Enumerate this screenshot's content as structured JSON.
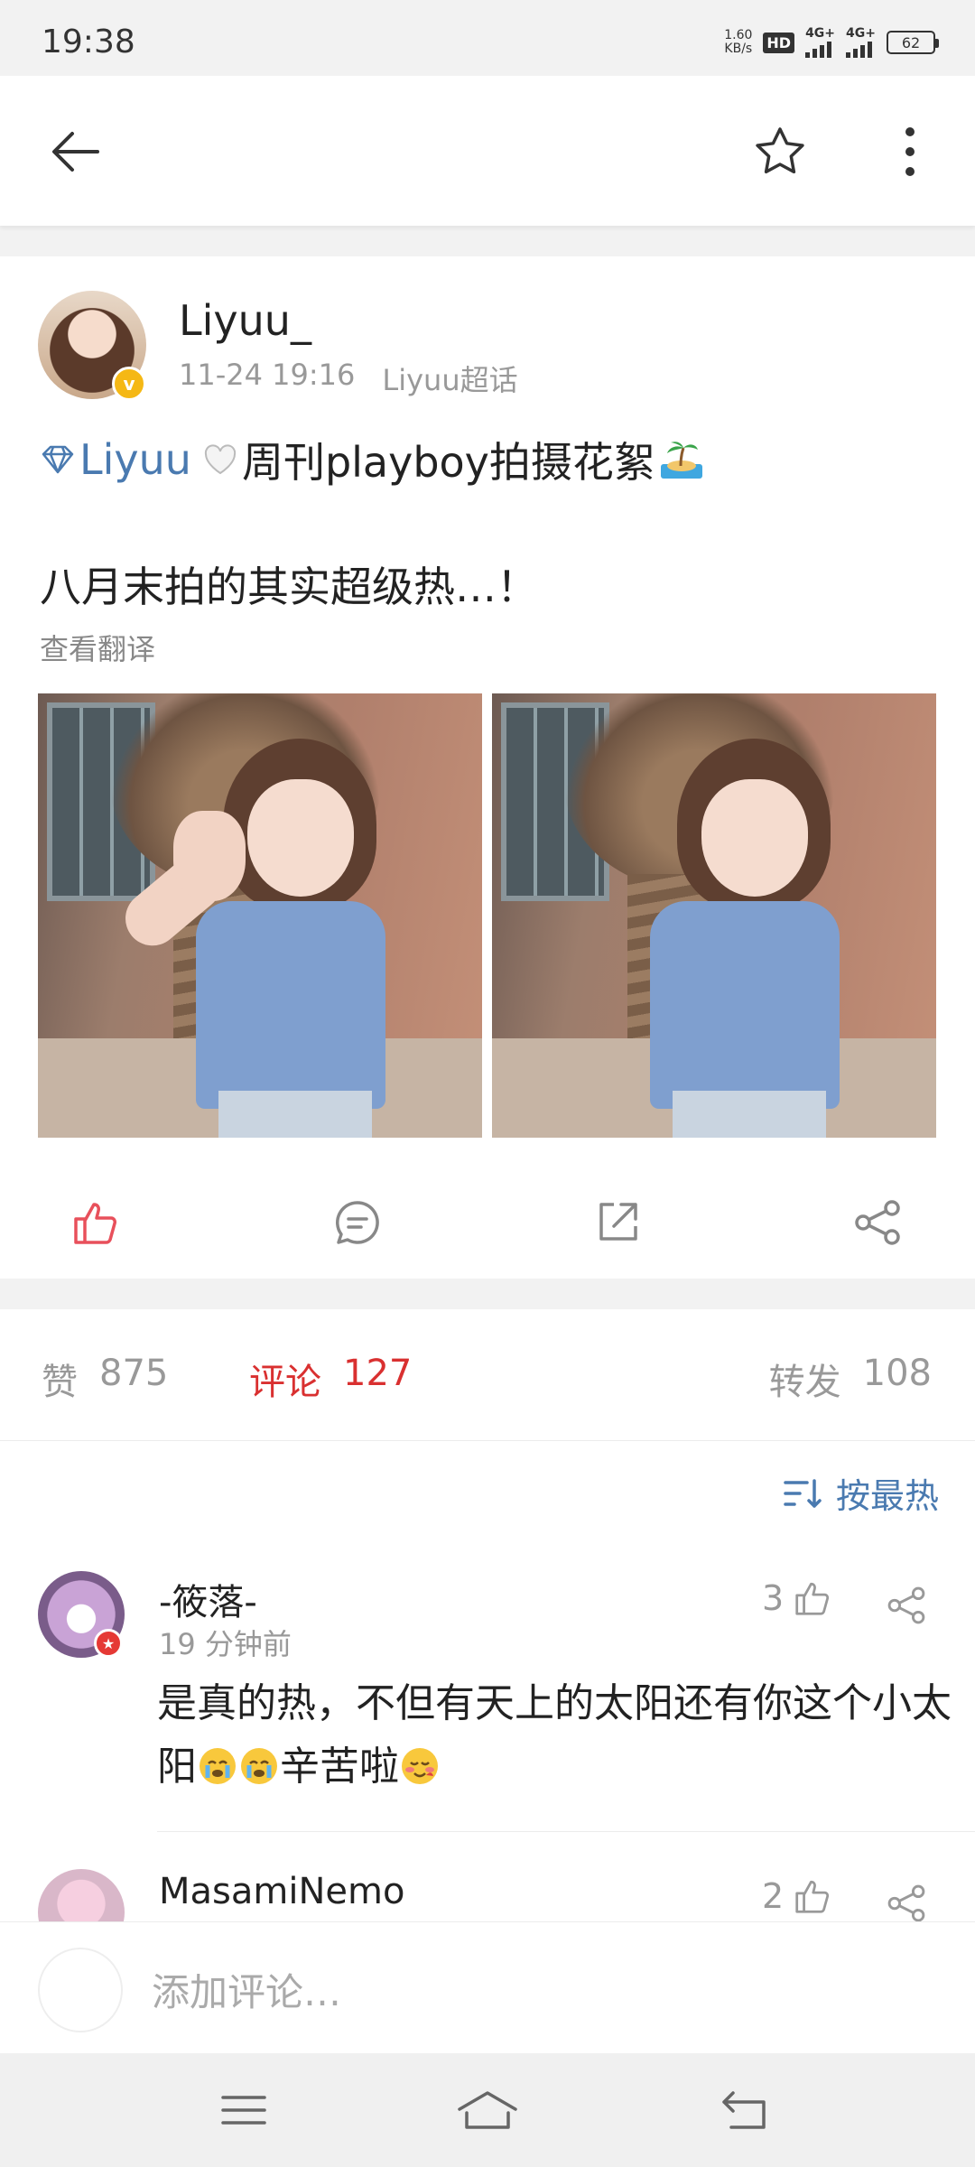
{
  "status_bar": {
    "time": "19:38",
    "net_speed_value": "1.60",
    "net_speed_unit": "KB/s",
    "hd_badge": "HD",
    "sim1_label": "4G+",
    "sim2_label": "4G+",
    "battery": "62"
  },
  "nav": {
    "back_icon": "arrow-left-icon",
    "star_icon": "star-icon",
    "more_icon": "more-vertical-icon"
  },
  "post": {
    "username": "Liyuu_",
    "date": "11-24 19:16",
    "source": "Liyuu超话",
    "topic": "Liyuu",
    "title_text": "周刊playboy拍摄花絮",
    "body": "八月末拍的其实超级热…！",
    "translate_link": "查看翻译",
    "verified_mark": "v",
    "accent_color": "#4a7ab0",
    "like_color": "#e8505b"
  },
  "stats": {
    "likes_label": "赞",
    "likes_count": "875",
    "comments_label": "评论",
    "comments_count": "127",
    "reposts_label": "转发",
    "reposts_count": "108",
    "sort_label": "按最热"
  },
  "comments": [
    {
      "name": "-筱落-",
      "time": "19 分钟前",
      "likes": "3",
      "text_part1": "是真的热，不但有天上的太阳还有你这个小太阳",
      "text_part2": "辛苦啦"
    },
    {
      "name": "MasamiNemo",
      "likes": "2"
    }
  ],
  "comment_bar": {
    "placeholder": "添加评论…"
  }
}
